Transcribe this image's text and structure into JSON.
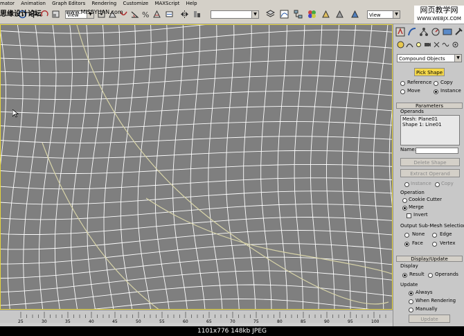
{
  "menubar": {
    "items": [
      "mator",
      "Animation",
      "Graph Editors",
      "Rendering",
      "Customize",
      "MAXScript",
      "Help"
    ]
  },
  "watermarks": {
    "left": "思缘设计论坛",
    "center": "www.MISSYUAN.com",
    "right_top": "网页教学网",
    "right_bottom": "WWW.WEBJX.COM"
  },
  "toolbar": {
    "view_dropdown": "View",
    "named_selection": "",
    "right_view_dropdown": "View"
  },
  "panel": {
    "category_dropdown": "Compound Objects",
    "pick_shape_button": "Pick Shape",
    "options": [
      "Reference",
      "Copy",
      "Move",
      "Instance"
    ],
    "selected_option": "Instance",
    "parameters_rollout": "Parameters",
    "operands_label": "Operands",
    "operands_list": [
      "Mesh: Plane01",
      "Shape 1: Line01"
    ],
    "name_label": "Name:",
    "name_value": "",
    "delete_shape_button": "Delete Shape",
    "extract_operand_button": "Extract Operand",
    "extract_options": [
      "Instance",
      "Copy"
    ],
    "operation_label": "Operation",
    "operations": [
      "Cookie Cutter",
      "Merge"
    ],
    "selected_operation": "Merge",
    "invert_label": "Invert",
    "invert_checked": false,
    "output_label": "Output Sub-Mesh Selection",
    "output_options": [
      "None",
      "Edge",
      "Face",
      "Vertex"
    ],
    "selected_output": "Face",
    "display_update_rollout": "Display/Update",
    "display_label": "Display",
    "display_options": [
      "Result",
      "Operands"
    ],
    "selected_display": "Result",
    "update_label": "Update",
    "update_options": [
      "Always",
      "When Rendering",
      "Manually"
    ],
    "selected_update": "Always",
    "update_button": "Update"
  },
  "timeline": {
    "ticks": [
      "25",
      "30",
      "35",
      "40",
      "45",
      "50",
      "55",
      "60",
      "65",
      "70",
      "75",
      "80",
      "85",
      "90",
      "95",
      "100"
    ]
  },
  "caption": "1101x776  148kb  JPEG",
  "colors": {
    "viewport_bg": "#7f7f7f",
    "grid_line": "#ffffff",
    "spline": "#d8d4a8",
    "active_border": "#e7d63c",
    "pick_shape_bg": "#f5d84a"
  }
}
